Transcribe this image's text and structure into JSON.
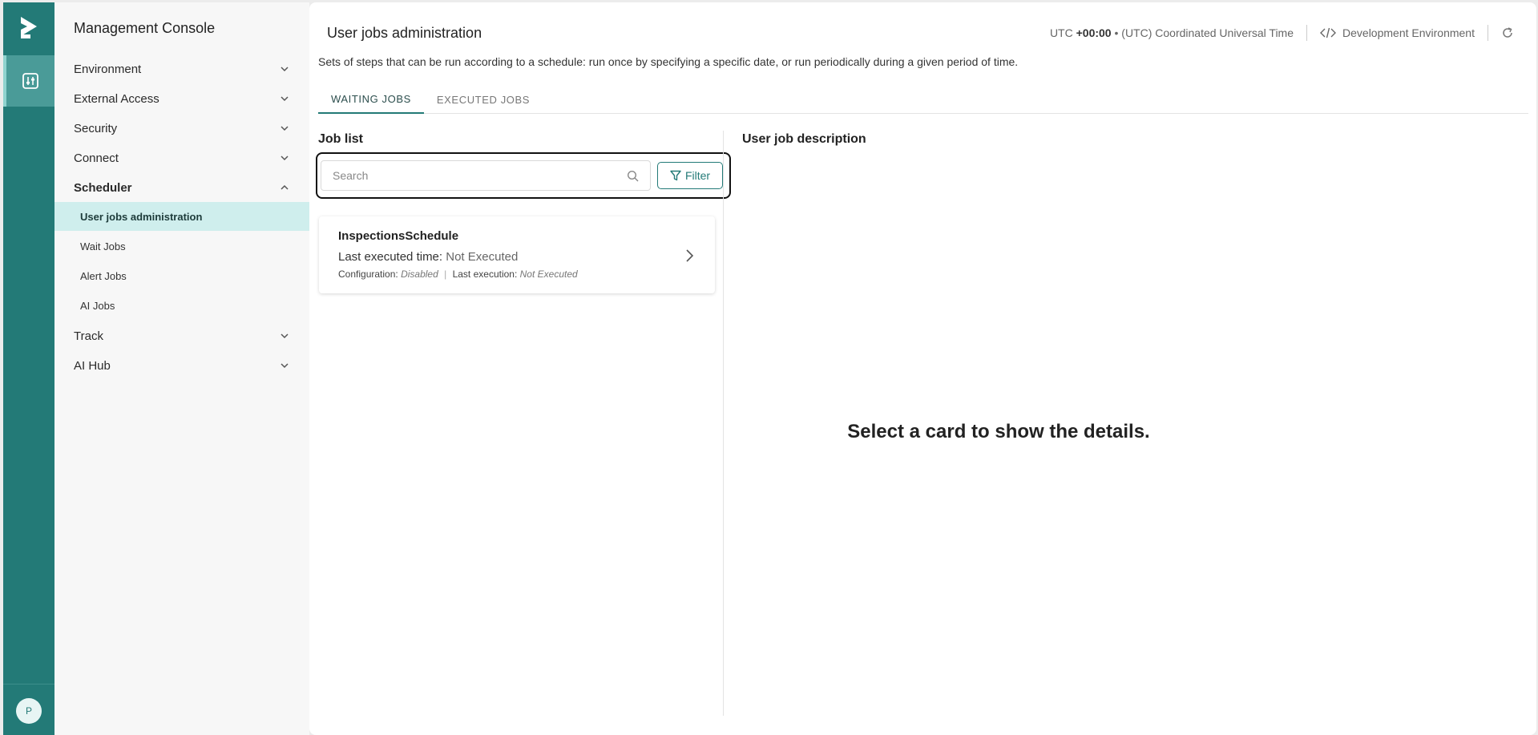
{
  "rail": {
    "avatar_initial": "P"
  },
  "nav": {
    "title": "Management Console",
    "sections": [
      {
        "label": "Environment"
      },
      {
        "label": "External Access"
      },
      {
        "label": "Security"
      },
      {
        "label": "Connect"
      },
      {
        "label": "Scheduler"
      },
      {
        "label": "Track"
      },
      {
        "label": "AI Hub"
      }
    ],
    "scheduler_items": [
      {
        "label": "User jobs administration",
        "active": true
      },
      {
        "label": "Wait Jobs"
      },
      {
        "label": "Alert Jobs"
      },
      {
        "label": "AI Jobs"
      }
    ]
  },
  "header": {
    "title": "User jobs administration",
    "timezone_prefix": "UTC",
    "timezone_offset": "+00:00",
    "timezone_name": "• (UTC) Coordinated Universal Time",
    "environment": "Development Environment"
  },
  "description": "Sets of steps that can be run according to a schedule: run once by specifying a specific date, or run periodically during a given period of time.",
  "tabs": [
    {
      "label": "WAITING JOBS",
      "active": true
    },
    {
      "label": "EXECUTED JOBS"
    }
  ],
  "job_list": {
    "title": "Job list",
    "search_placeholder": "Search",
    "filter_label": "Filter",
    "jobs": [
      {
        "name": "InspectionsSchedule",
        "last_time_label": "Last executed time:",
        "last_time_value": "Not Executed",
        "config_label": "Configuration:",
        "config_value": "Disabled",
        "last_exec_label": "Last execution:",
        "last_exec_value": "Not Executed"
      }
    ]
  },
  "detail": {
    "title": "User job description",
    "empty_message": "Select a card to show the details."
  },
  "colors": {
    "brand": "#237a77",
    "active_nav_bg": "#cfeeed"
  },
  "icons": [
    "logo-icon",
    "settings-sliders-icon",
    "chevron-down-icon",
    "chevron-up-icon",
    "code-icon",
    "refresh-icon",
    "search-icon",
    "filter-icon",
    "chevron-right-icon"
  ]
}
